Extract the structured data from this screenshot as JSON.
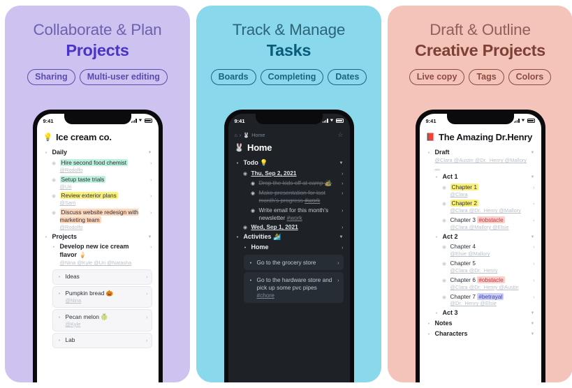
{
  "panels": [
    {
      "id": "collaborate",
      "bg": "#cdc2f0",
      "heading_line1": "Collaborate & Plan",
      "heading_line2": "Projects",
      "pills": [
        "Sharing",
        "Multi-user editing"
      ],
      "phone": {
        "theme": "light",
        "status": {
          "time": "9:41"
        },
        "doc_emoji": "💡",
        "doc_title": "Ice cream co.",
        "items": [
          {
            "kind": "section",
            "text": "Daily"
          },
          {
            "kind": "task",
            "indent": 1,
            "text": "Hire second food chemist",
            "highlight": "green",
            "mentions": "@Rodolfo"
          },
          {
            "kind": "task",
            "indent": 1,
            "text": "Setup taste trials",
            "highlight": "green",
            "mentions": "@Uri"
          },
          {
            "kind": "task",
            "indent": 1,
            "text": "Review exterior plans",
            "highlight": "yellow",
            "mentions": "@Sam"
          },
          {
            "kind": "task",
            "indent": 1,
            "text": "Discuss website redesign with marketing team",
            "highlight": "orange",
            "mentions": "@Rodolfo"
          },
          {
            "kind": "section",
            "text": "Projects"
          },
          {
            "kind": "subsection",
            "indent": 1,
            "text": "Develop new ice cream flavor",
            "emoji": "🍦",
            "mentions": "@Nina @Kyle @Uri @Natasha"
          },
          {
            "kind": "card",
            "indent": 2,
            "text": "Ideas"
          },
          {
            "kind": "carditem",
            "indent": 3,
            "text": "Pumpkin bread",
            "emoji": "🎃",
            "mentions": "@Nina"
          },
          {
            "kind": "carditem",
            "indent": 3,
            "text": "Pecan melon",
            "emoji": "🍈",
            "mentions": "@Kyle"
          },
          {
            "kind": "cardtail",
            "indent": 2,
            "text": "Lab"
          }
        ]
      }
    },
    {
      "id": "track",
      "bg": "#8ad8ec",
      "heading_line1": "Track & Manage",
      "heading_line2": "Tasks",
      "pills": [
        "Boards",
        "Completing",
        "Dates"
      ],
      "phone": {
        "theme": "dark",
        "status": {
          "time": "9:41"
        },
        "breadcrumb": {
          "home_icon": "home-icon",
          "separator": "›",
          "label": "Home",
          "star": "☆"
        },
        "doc_emoji": "🐰",
        "doc_title": "Home",
        "items": [
          {
            "kind": "section",
            "text": "Todo",
            "emoji": "💡"
          },
          {
            "kind": "date",
            "indent": 1,
            "text": "Thu, Sep 2, 2021"
          },
          {
            "kind": "done",
            "indent": 2,
            "text": "Drop the kids off at camp",
            "emoji": "🏕️"
          },
          {
            "kind": "done",
            "indent": 2,
            "text": "Make presentation for last month's progress",
            "tag": "#work"
          },
          {
            "kind": "task",
            "indent": 2,
            "text": "Write email for this month's newsletter",
            "tag": "#work"
          },
          {
            "kind": "date",
            "indent": 1,
            "text": "Wed, Sep 1, 2021"
          },
          {
            "kind": "section",
            "text": "Activities",
            "emoji": "🏄"
          },
          {
            "kind": "subsection",
            "indent": 1,
            "text": "Home"
          },
          {
            "kind": "dcard",
            "indent": 2,
            "text": "Go to the grocery store"
          },
          {
            "kind": "dcard",
            "indent": 2,
            "text": "Go to the hardware store and pick up some pvc pipes",
            "tag": "#chore"
          }
        ]
      }
    },
    {
      "id": "draft",
      "bg": "#f4c4bb",
      "heading_line1": "Draft & Outline",
      "heading_line2": "Creative Projects",
      "pills": [
        "Live copy",
        "Tags",
        "Colors"
      ],
      "phone": {
        "theme": "light",
        "status": {
          "time": "9:41"
        },
        "doc_emoji": "📕",
        "doc_title": "The Amazing Dr.Henry",
        "items": [
          {
            "kind": "section",
            "text": "Draft",
            "mentions": "@Clara @Austin @Dr._Henry @Mallory …"
          },
          {
            "kind": "section2",
            "indent": 1,
            "text": "Act 1"
          },
          {
            "kind": "task",
            "indent": 2,
            "text": "Chapter 1",
            "highlight": "yellow",
            "mentions": "@Clara"
          },
          {
            "kind": "task",
            "indent": 2,
            "text": "Chapter 2",
            "highlight": "yellow",
            "mentions": "@Clara @Dr._Henry @Mallory"
          },
          {
            "kind": "task",
            "indent": 2,
            "text": "Chapter 3",
            "tag": "#obstacle",
            "tag_color": "pink",
            "mentions": "@Clara @Mallory @Elsie"
          },
          {
            "kind": "section2",
            "indent": 1,
            "text": "Act 2"
          },
          {
            "kind": "task",
            "indent": 2,
            "text": "Chapter 4",
            "mentions": "@Elsie @Mallory"
          },
          {
            "kind": "task",
            "indent": 2,
            "text": "Chapter 5",
            "mentions": "@Clara @Dr._Henry"
          },
          {
            "kind": "task",
            "indent": 2,
            "text": "Chapter 6",
            "tag": "#obstacle",
            "tag_color": "pink",
            "mentions": "@Clara @Dr._Henry @Austin"
          },
          {
            "kind": "task",
            "indent": 2,
            "text": "Chapter 7",
            "tag": "#betrayal",
            "tag_color": "violet",
            "mentions": "@Dr._Henry @Elsie"
          },
          {
            "kind": "section2",
            "indent": 1,
            "text": "Act 3"
          },
          {
            "kind": "section",
            "text": "Notes"
          },
          {
            "kind": "section",
            "text": "Characters"
          }
        ]
      }
    }
  ]
}
